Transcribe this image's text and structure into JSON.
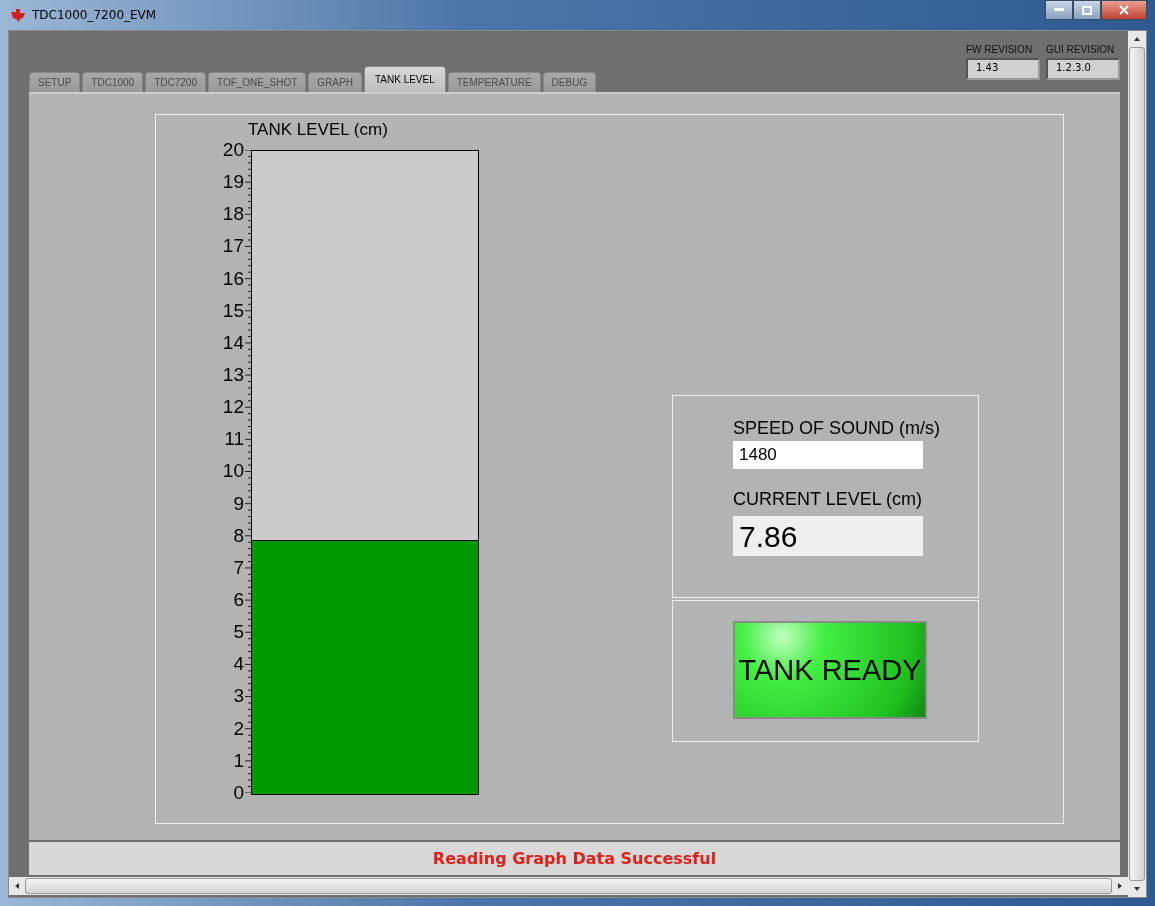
{
  "window": {
    "title": "TDC1000_7200_EVM"
  },
  "tabs": [
    {
      "label": "SETUP",
      "selected": false
    },
    {
      "label": "TDC1000",
      "selected": false
    },
    {
      "label": "TDC7200",
      "selected": false
    },
    {
      "label": "TOF_ONE_SHOT",
      "selected": false
    },
    {
      "label": "GRAPH",
      "selected": false
    },
    {
      "label": "TANK LEVEL",
      "selected": true
    },
    {
      "label": "TEMPERATURE",
      "selected": false
    },
    {
      "label": "DEBUG",
      "selected": false
    }
  ],
  "revisions": [
    {
      "label": "FW REVISION",
      "value": "1.43"
    },
    {
      "label": "GUI REVISION",
      "value": "1.2.3.0"
    }
  ],
  "tank": {
    "title": "TANK LEVEL (cm)",
    "level": 0.393,
    "scale": [
      "20",
      "19",
      "18",
      "17",
      "16",
      "15",
      "14",
      "13",
      "12",
      "11",
      "10",
      "9",
      "8",
      "7",
      "6",
      "5",
      "4",
      "3",
      "2",
      "1",
      "0"
    ]
  },
  "speed_of_sound": {
    "label": "SPEED OF SOUND (m/s)",
    "value": "1480"
  },
  "current_level": {
    "label": "CURRENT LEVEL (cm)",
    "value": "7.86"
  },
  "tank_ready": {
    "label": "TANK READY",
    "on": true
  },
  "status_bar": {
    "text": "Reading Graph Data Successful"
  }
}
